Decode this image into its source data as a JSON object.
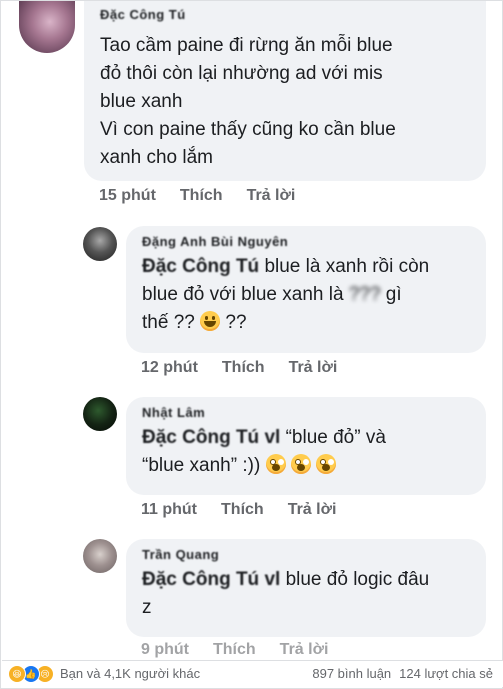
{
  "comments": [
    {
      "name": "Đặc Công Tú",
      "lines": [
        "Tao cầm paine đi rừng ăn mỗi blue",
        "đỏ thôi còn lại nhường ad với mis",
        "blue xanh",
        "Vì con paine thấy cũng ko cần blue",
        "xanh cho lắm"
      ],
      "time": "15 phút",
      "like": "Thích",
      "reply": "Trả lời"
    },
    {
      "name": "Đặng Anh Bùi Nguyên",
      "mention": "Đặc Công Tú",
      "line1_rest": " blue là xanh rồi còn",
      "line2_a": "blue đỏ với blue xanh là ",
      "censored": "???",
      "line2_b": " gì",
      "line3": "thế ?? ",
      "line3_b": " ??",
      "time": "12 phút",
      "like": "Thích",
      "reply": "Trả lời"
    },
    {
      "name": "Nhật Lâm",
      "mention": "Đặc Công Tú vl",
      "line1_rest": " “blue đỏ” và",
      "line2": "“blue xanh” :)) ",
      "time": "11 phút",
      "like": "Thích",
      "reply": "Trả lời"
    },
    {
      "name": "Trần Quang",
      "mention": "Đặc Công Tú vl",
      "line1_rest": " blue đỏ logic đâu",
      "line2": "z",
      "time": "9 phút",
      "like": "Thích",
      "reply": "Trả lời"
    }
  ],
  "footer": {
    "reactors": "Bạn và 4,1K người khác",
    "comments": "897 bình luận",
    "shares": "124 lượt chia sẻ"
  },
  "colors": {
    "bubble": "#f0f2f5",
    "meta": "#65676b",
    "like": "#1877f2",
    "haha": "#f7b125",
    "sad": "#f7b125"
  },
  "icons": [
    "haha-react-icon",
    "like-react-icon",
    "sad-react-icon",
    "grinning-emoji-icon",
    "screaming-emoji-icon"
  ]
}
